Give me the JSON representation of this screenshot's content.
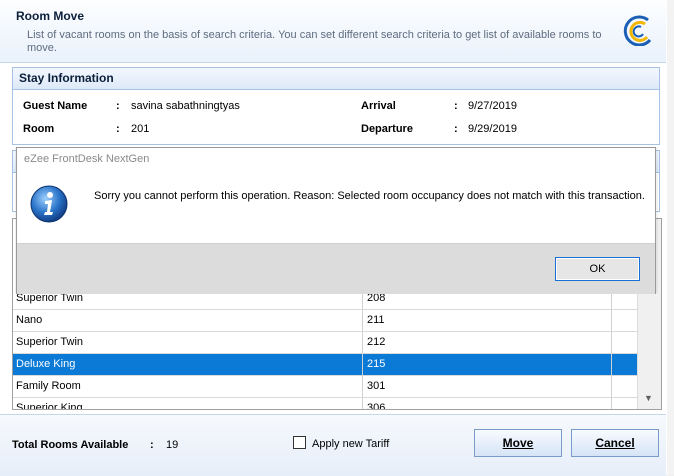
{
  "header": {
    "title": "Room Move",
    "description": "List of vacant rooms on the basis of search criteria. You can set different search criteria to get list of available rooms to move."
  },
  "stay": {
    "heading": "Stay Information",
    "guest_label": "Guest Name",
    "guest_value": "savina sabathningtyas",
    "room_label": "Room",
    "room_value": "201",
    "arrival_label": "Arrival",
    "arrival_value": "9/27/2019",
    "departure_label": "Departure",
    "departure_value": "9/29/2019",
    "colon": ":"
  },
  "rooms": [
    {
      "type": "Superior Twin",
      "room": "208"
    },
    {
      "type": "Nano",
      "room": "211"
    },
    {
      "type": "Superior Twin",
      "room": "212"
    },
    {
      "type": "Deluxe King",
      "room": "215",
      "selected": true
    },
    {
      "type": "Family Room",
      "room": "301"
    },
    {
      "type": "Superior King",
      "room": "306"
    }
  ],
  "footer": {
    "total_label": "Total Rooms Available",
    "colon": ":",
    "total_value": "19",
    "tariff_label": "Apply new Tariff",
    "tariff_checked": false,
    "move_label": "Move",
    "cancel_label": "Cancel"
  },
  "dialog": {
    "title": "eZee FrontDesk NextGen",
    "message": "Sorry you cannot perform this operation. Reason: Selected room occupancy does not match with this transaction.",
    "ok_label": "OK",
    "icon": "info-icon"
  },
  "colors": {
    "accent": "#0a7ad6",
    "panel_border": "#a7c1e3"
  }
}
